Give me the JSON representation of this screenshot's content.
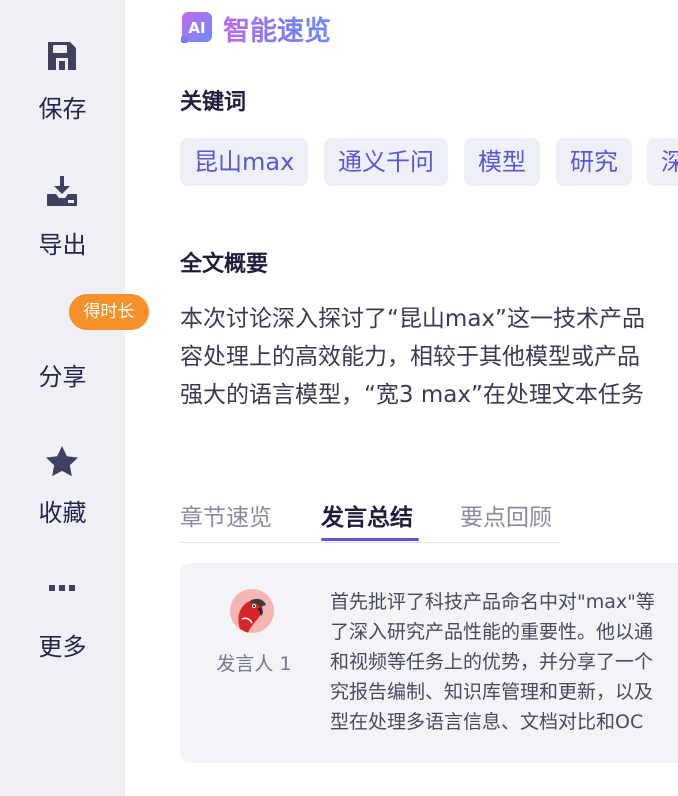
{
  "sidebar": {
    "items": [
      {
        "label": "保存",
        "icon": "save-icon"
      },
      {
        "label": "导出",
        "icon": "export-icon"
      },
      {
        "label": "分享",
        "icon": "share-icon",
        "badge": "得时长"
      },
      {
        "label": "收藏",
        "icon": "star-icon"
      },
      {
        "label": "更多",
        "icon": "more-icon"
      }
    ]
  },
  "header": {
    "title": "智能速览",
    "logo": "AI"
  },
  "keywords": {
    "title": "关键词",
    "tags": [
      "昆山max",
      "通义千问",
      "模型",
      "研究",
      "深"
    ]
  },
  "overview": {
    "title": "全文概要",
    "lines": [
      "本次讨论深入探讨了“昆山max”这一技术产品",
      "容处理上的高效能力，相较于其他模型或产品",
      "强大的语言模型，“宽3 max”在处理文本任务"
    ]
  },
  "tabs": [
    {
      "label": "章节速览",
      "active": false
    },
    {
      "label": "发言总结",
      "active": true
    },
    {
      "label": "要点回顾",
      "active": false
    }
  ],
  "speaker_card": {
    "speaker": "发言人 1",
    "lines": [
      "首先批评了科技产品命名中对\"max\"等",
      "了深入研究产品性能的重要性。他以通",
      "和视频等任务上的优势，并分享了一个",
      "究报告编制、知识库管理和更新，以及",
      "型在处理多语言信息、文档对比和OC"
    ]
  },
  "colors": {
    "accent": "#5a56d6",
    "badge": "#f5902a",
    "sidebar_bg": "#eef0f6",
    "tag_bg": "#eef0f8"
  }
}
